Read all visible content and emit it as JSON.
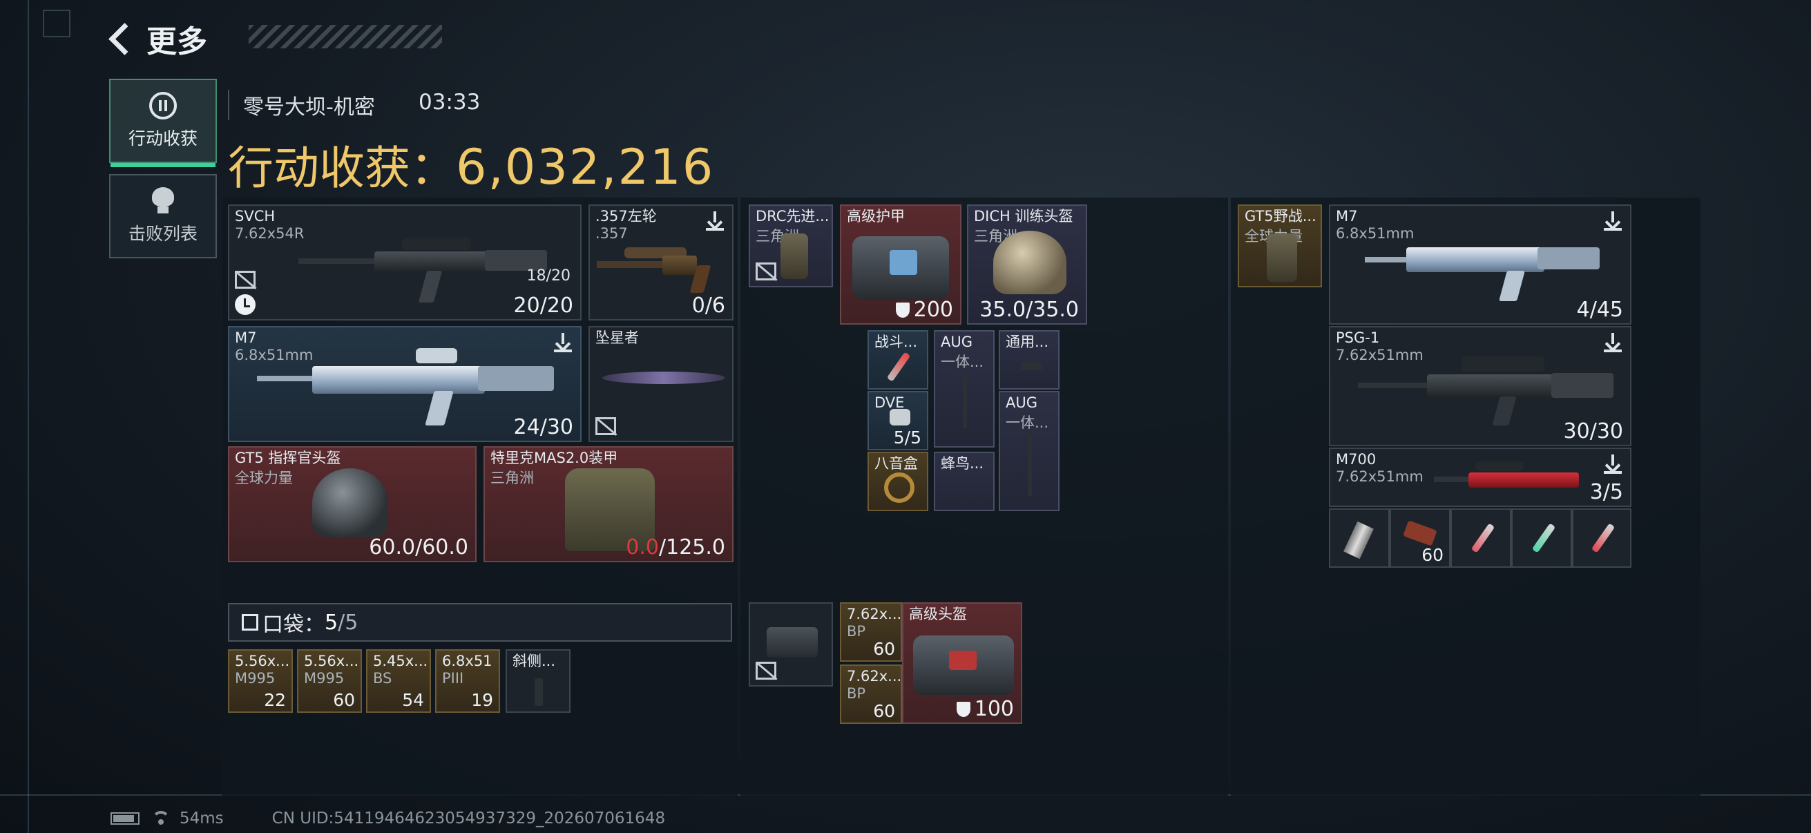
{
  "header": {
    "back_label": "更多"
  },
  "tabs": [
    {
      "label": "行动收获",
      "icon": "loot-icon",
      "active": true
    },
    {
      "label": "击败列表",
      "icon": "skull-icon",
      "active": false
    }
  ],
  "raid": {
    "map": "零号大坝-机密",
    "time": "03:33"
  },
  "loot": {
    "label": "行动收获：",
    "value": "6,032,216"
  },
  "left_panel": {
    "svch": {
      "name": "SVCH",
      "ammo_type": "7.62x54R",
      "mag_in": "18/20",
      "count": "20/20"
    },
    "revolver": {
      "name": ".357左轮",
      "ammo_type": ".357",
      "count": "0/6"
    },
    "m7": {
      "name": "M7",
      "ammo_type": "6.8x51mm",
      "count": "24/30"
    },
    "knife": {
      "name": "坠星者"
    },
    "helmet": {
      "name": "GT5 指挥官头盔",
      "brand": "全球力量",
      "durability": "60.0/60.0"
    },
    "armor": {
      "name": "特里克MAS2.0装甲",
      "brand": "三角洲",
      "durability_cur": "0.0",
      "durability_max": "/125.0"
    },
    "pouch": {
      "label": "口袋：",
      "count": "5",
      "max": "/5"
    },
    "pouch_items": [
      {
        "name": "5.56x...",
        "sub": "M995",
        "count": "22"
      },
      {
        "name": "5.56x...",
        "sub": "M995",
        "count": "60"
      },
      {
        "name": "5.45x...",
        "sub": "BS",
        "count": "54"
      },
      {
        "name": "6.8x51",
        "sub": "PIII",
        "count": "19"
      },
      {
        "name": "斜侧...",
        "sub": "",
        "count": ""
      }
    ]
  },
  "mid_panel": {
    "rig": {
      "name": "DRC先进...",
      "brand": "三角洲"
    },
    "backpack": {
      "name": "高级护甲",
      "count": "200"
    },
    "helmet": {
      "name": "DICH 训练头盔",
      "brand": "三角洲",
      "durability": "35.0/35.0"
    },
    "small_items": [
      {
        "name": "战斗...",
        "sub": "",
        "count": ""
      },
      {
        "name": "AUG",
        "sub": "一体...",
        "count": ""
      },
      {
        "name": "通用...",
        "sub": "",
        "count": ""
      },
      {
        "name": "DVE",
        "sub": "",
        "count": "5/5"
      },
      {
        "name": "AUG",
        "sub": "一体...",
        "count": ""
      },
      {
        "name": "八音盒",
        "sub": "",
        "count": ""
      },
      {
        "name": "蜂鸟...",
        "sub": "",
        "count": ""
      }
    ],
    "case": {
      "name": ""
    },
    "ammo": [
      {
        "name": "7.62x...",
        "sub": "BP",
        "count": "60"
      },
      {
        "name": "7.62x...",
        "sub": "BP",
        "count": "60"
      }
    ],
    "bag2": {
      "name": "高级头盔",
      "count": "100"
    }
  },
  "right_panel": {
    "rig": {
      "name": "GT5野战...",
      "brand": "全球力量"
    },
    "m7": {
      "name": "M7",
      "ammo_type": "6.8x51mm",
      "count": "4/45"
    },
    "psg": {
      "name": "PSG-1",
      "ammo_type": "7.62x51mm",
      "count": "30/30"
    },
    "m700": {
      "name": "M700",
      "ammo_type": "7.62x51mm",
      "count": "3/5"
    },
    "consumables": [
      {
        "name": "",
        "count": ""
      },
      {
        "name": "",
        "count": "60"
      },
      {
        "name": "",
        "count": ""
      },
      {
        "name": "",
        "count": ""
      },
      {
        "name": "",
        "count": ""
      }
    ]
  },
  "status": {
    "ping": "54ms",
    "uid": "CN UID:5411946462305493​7329_202607061648"
  },
  "colors": {
    "gold": "#f0c869",
    "accent_green": "#37d39a",
    "danger": "#e0383a"
  }
}
